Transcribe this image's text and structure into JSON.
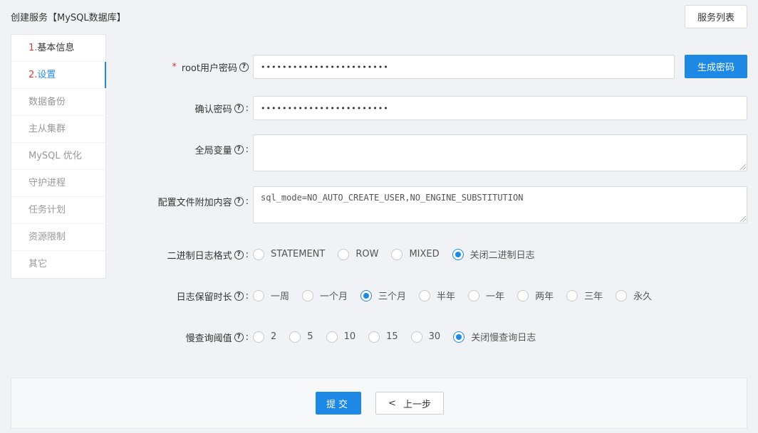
{
  "header": {
    "title": "创建服务【MySQL数据库】",
    "service_list_button": "服务列表"
  },
  "sidebar": {
    "items": [
      {
        "num": "1.",
        "label": "基本信息",
        "state": "done"
      },
      {
        "num": "2.",
        "label": "设置",
        "state": "active"
      },
      {
        "num": "",
        "label": "数据备份",
        "state": "pending"
      },
      {
        "num": "",
        "label": "主从集群",
        "state": "pending"
      },
      {
        "num": "",
        "label": "MySQL 优化",
        "state": "pending"
      },
      {
        "num": "",
        "label": "守护进程",
        "state": "pending"
      },
      {
        "num": "",
        "label": "任务计划",
        "state": "pending"
      },
      {
        "num": "",
        "label": "资源限制",
        "state": "pending"
      },
      {
        "num": "",
        "label": "其它",
        "state": "pending"
      }
    ]
  },
  "form": {
    "root_password": {
      "required_mark": "*",
      "label": "root用户密码",
      "value": "••••••••••••••••••••••••",
      "generate_button": "生成密码"
    },
    "confirm_password": {
      "label": "确认密码",
      "value": "••••••••••••••••••••••••"
    },
    "global_vars": {
      "label": "全局变量",
      "value": ""
    },
    "config_append": {
      "label": "配置文件附加内容",
      "value": "sql_mode=NO_AUTO_CREATE_USER,NO_ENGINE_SUBSTITUTION"
    },
    "binlog_format": {
      "label": "二进制日志格式",
      "options": [
        "STATEMENT",
        "ROW",
        "MIXED",
        "关闭二进制日志"
      ],
      "selected": "关闭二进制日志"
    },
    "log_retention": {
      "label": "日志保留时长",
      "options": [
        "一周",
        "一个月",
        "三个月",
        "半年",
        "一年",
        "两年",
        "三年",
        "永久"
      ],
      "selected": "三个月"
    },
    "slow_query": {
      "label": "慢查询阈值",
      "options": [
        "2",
        "5",
        "10",
        "15",
        "30",
        "关闭慢查询日志"
      ],
      "selected": "关闭慢查询日志"
    },
    "label_colon": ":",
    "help_glyph": "?"
  },
  "footer": {
    "submit": "提交",
    "prev": "上一步",
    "prev_arrow": "<"
  },
  "colors": {
    "accent": "#1e88e5",
    "required": "#e53935",
    "background": "#f0f2f5"
  }
}
